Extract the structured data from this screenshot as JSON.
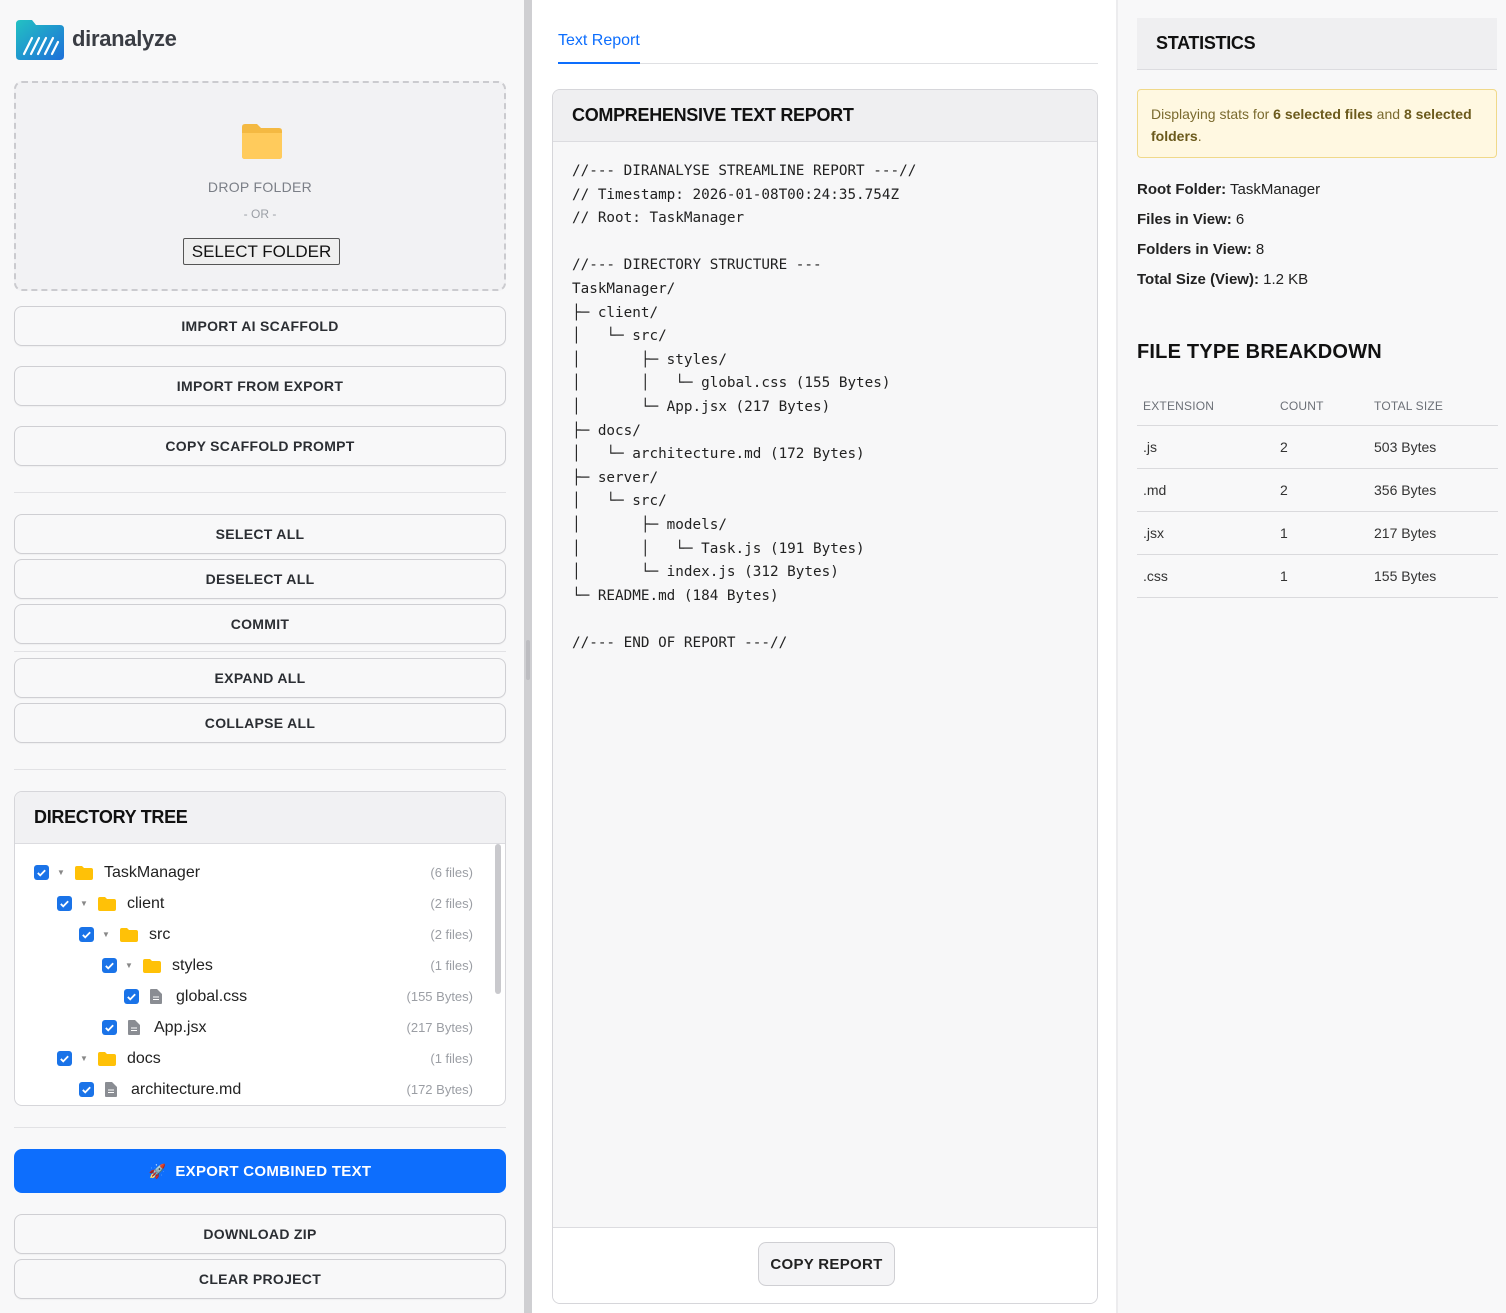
{
  "app": {
    "name": "diranalyze"
  },
  "dropzone": {
    "title": "DROP FOLDER",
    "or": "- OR -",
    "select_button": "SELECT FOLDER"
  },
  "actions": {
    "import_ai_scaffold": "IMPORT AI SCAFFOLD",
    "import_from_export": "IMPORT FROM EXPORT",
    "copy_scaffold_prompt": "COPY SCAFFOLD PROMPT",
    "select_all": "SELECT ALL",
    "deselect_all": "DESELECT ALL",
    "commit": "COMMIT",
    "expand_all": "EXPAND ALL",
    "collapse_all": "COLLAPSE ALL",
    "export_combined_text": "EXPORT COMBINED TEXT",
    "download_zip": "DOWNLOAD ZIP",
    "clear_project": "CLEAR PROJECT"
  },
  "tree": {
    "title": "DIRECTORY TREE",
    "items": [
      {
        "name": "TaskManager",
        "meta": "(6 files)",
        "type": "folder",
        "checked": true
      },
      {
        "name": "client",
        "meta": "(2 files)",
        "type": "folder",
        "checked": true
      },
      {
        "name": "src",
        "meta": "(2 files)",
        "type": "folder",
        "checked": true
      },
      {
        "name": "styles",
        "meta": "(1 files)",
        "type": "folder",
        "checked": true
      },
      {
        "name": "global.css",
        "meta": "(155 Bytes)",
        "type": "file",
        "checked": true
      },
      {
        "name": "App.jsx",
        "meta": "(217 Bytes)",
        "type": "file",
        "checked": true
      },
      {
        "name": "docs",
        "meta": "(1 files)",
        "type": "folder",
        "checked": true
      },
      {
        "name": "architecture.md",
        "meta": "(172 Bytes)",
        "type": "file",
        "checked": true
      }
    ]
  },
  "report": {
    "tab": "Text Report",
    "title": "COMPREHENSIVE TEXT REPORT",
    "lines": [
      "//--- DIRANALYSE STREAMLINE REPORT ---//",
      "// Timestamp: 2026-01-08T00:24:35.754Z",
      "// Root: TaskManager",
      "",
      "//--- DIRECTORY STRUCTURE ---",
      "TaskManager/",
      "├─ client/",
      "│   └─ src/",
      "│       ├─ styles/",
      "│       │   └─ global.css (155 Bytes)",
      "│       └─ App.jsx (217 Bytes)",
      "├─ docs/",
      "│   └─ architecture.md (172 Bytes)",
      "├─ server/",
      "│   └─ src/",
      "│       ├─ models/",
      "│       │   └─ Task.js (191 Bytes)",
      "│       └─ index.js (312 Bytes)",
      "└─ README.md (184 Bytes)",
      "",
      "//--- END OF REPORT ---//"
    ],
    "copy_button": "COPY REPORT"
  },
  "stats": {
    "title": "STATISTICS",
    "notice": {
      "prefix": "Displaying stats for ",
      "files": "6 selected files",
      "middle": " and ",
      "folders": "8 selected folders",
      "suffix": "."
    },
    "root_label": "Root Folder:",
    "root_value": " TaskManager",
    "files_label": "Files in View:",
    "files_value": " 6",
    "folders_label": "Folders in View:",
    "folders_value": " 8",
    "size_label": "Total Size (View):",
    "size_value": " 1.2 KB"
  },
  "breakdown": {
    "title": "FILE TYPE BREAKDOWN",
    "columns": [
      "EXTENSION",
      "COUNT",
      "TOTAL SIZE"
    ],
    "rows": [
      [
        ".js",
        "2",
        "503 Bytes"
      ],
      [
        ".md",
        "2",
        "356 Bytes"
      ],
      [
        ".jsx",
        "1",
        "217 Bytes"
      ],
      [
        ".css",
        "1",
        "155 Bytes"
      ]
    ]
  },
  "colors": {
    "accent": "#0d6efd",
    "checkbox": "#1a73e8",
    "folder": "#ffc107",
    "notice_bg": "#fff8e1"
  }
}
